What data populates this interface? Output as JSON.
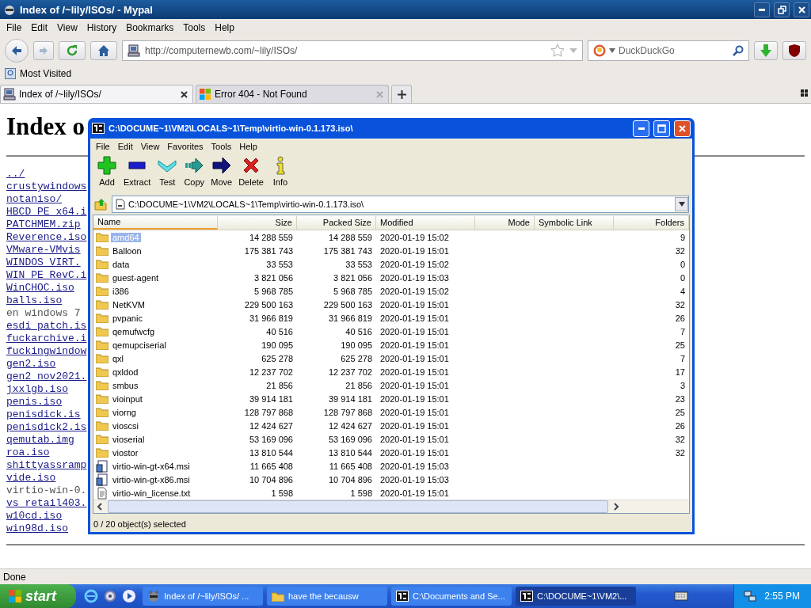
{
  "browser": {
    "title": "Index of /~lily/ISOs/ - Mypal",
    "menu": [
      "File",
      "Edit",
      "View",
      "History",
      "Bookmarks",
      "Tools",
      "Help"
    ],
    "url": "http://computernewb.com/~lily/ISOs/",
    "search": {
      "placeholder": "DuckDuckGo"
    },
    "bookmarks": [
      "Most Visited"
    ],
    "tabs": [
      {
        "label": "Index of /~lily/ISOs/",
        "selected": true,
        "kind": "page"
      },
      {
        "label": "Error 404 - Not Found",
        "selected": false,
        "kind": "error"
      }
    ],
    "status": "Done"
  },
  "page": {
    "heading": "Index o",
    "links": [
      {
        "text": "../",
        "visited": false
      },
      {
        "text": "crustywindows",
        "visited": false
      },
      {
        "text": "notaniso/",
        "visited": false
      },
      {
        "text": "HBCD PE x64.i",
        "visited": false
      },
      {
        "text": "PATCHMEM.zip",
        "visited": false
      },
      {
        "text": "Reverence.iso",
        "visited": false
      },
      {
        "text": "VMware-VMvis",
        "visited": false
      },
      {
        "text": "WINDOS VIRT.",
        "visited": false
      },
      {
        "text": "WIN PE RevC.i",
        "visited": false
      },
      {
        "text": "WinCHOC.iso",
        "visited": false
      },
      {
        "text": "balls.iso",
        "visited": false
      },
      {
        "text": "en windows 7",
        "visited": true
      },
      {
        "text": "esdi patch.is",
        "visited": false
      },
      {
        "text": "fuckarchive.i",
        "visited": false
      },
      {
        "text": "fuckingwindow",
        "visited": false
      },
      {
        "text": "gen2.iso",
        "visited": false
      },
      {
        "text": "gen2 nov2021.",
        "visited": false
      },
      {
        "text": "jxxlgb.iso",
        "visited": false
      },
      {
        "text": "penis.iso",
        "visited": false
      },
      {
        "text": "penisdick.is",
        "visited": false
      },
      {
        "text": "penisdick2.is",
        "visited": false
      },
      {
        "text": "qemutab.img",
        "visited": false
      },
      {
        "text": "roa.iso",
        "visited": false
      },
      {
        "text": "shittyassramp",
        "visited": false
      },
      {
        "text": "vide.iso",
        "visited": false
      },
      {
        "text": "virtio-win-0.",
        "visited": true
      },
      {
        "text": "vs retail403.",
        "visited": false
      },
      {
        "text": "w10cd.iso",
        "visited": false
      },
      {
        "text": "win98d.iso",
        "visited": false
      }
    ]
  },
  "archive_window": {
    "title": "C:\\DOCUME~1\\VM2\\LOCALS~1\\Temp\\virtio-win-0.1.173.iso\\",
    "menu": [
      "File",
      "Edit",
      "View",
      "Favorites",
      "Tools",
      "Help"
    ],
    "toolbar": [
      "Add",
      "Extract",
      "Test",
      "Copy",
      "Move",
      "Delete",
      "Info"
    ],
    "path": "C:\\DOCUME~1\\VM2\\LOCALS~1\\Temp\\virtio-win-0.1.173.iso\\",
    "columns": [
      "Name",
      "Size",
      "Packed Size",
      "Modified",
      "Mode",
      "Symbolic Link",
      "Folders"
    ],
    "rows": [
      {
        "kind": "folder",
        "name": "amd64",
        "size": "14 288 559",
        "packed_size": "14 288 559",
        "modified": "2020-01-19 15:02",
        "folders": "9",
        "selected": true
      },
      {
        "kind": "folder",
        "name": "Balloon",
        "size": "175 381 743",
        "packed_size": "175 381 743",
        "modified": "2020-01-19 15:01",
        "folders": "32",
        "selected": false
      },
      {
        "kind": "folder",
        "name": "data",
        "size": "33 553",
        "packed_size": "33 553",
        "modified": "2020-01-19 15:02",
        "folders": "0",
        "selected": false
      },
      {
        "kind": "folder",
        "name": "guest-agent",
        "size": "3 821 056",
        "packed_size": "3 821 056",
        "modified": "2020-01-19 15:03",
        "folders": "0",
        "selected": false
      },
      {
        "kind": "folder",
        "name": "i386",
        "size": "5 968 785",
        "packed_size": "5 968 785",
        "modified": "2020-01-19 15:02",
        "folders": "4",
        "selected": false
      },
      {
        "kind": "folder",
        "name": "NetKVM",
        "size": "229 500 163",
        "packed_size": "229 500 163",
        "modified": "2020-01-19 15:01",
        "folders": "32",
        "selected": false
      },
      {
        "kind": "folder",
        "name": "pvpanic",
        "size": "31 966 819",
        "packed_size": "31 966 819",
        "modified": "2020-01-19 15:01",
        "folders": "26",
        "selected": false
      },
      {
        "kind": "folder",
        "name": "qemufwcfg",
        "size": "40 516",
        "packed_size": "40 516",
        "modified": "2020-01-19 15:01",
        "folders": "7",
        "selected": false
      },
      {
        "kind": "folder",
        "name": "qemupciserial",
        "size": "190 095",
        "packed_size": "190 095",
        "modified": "2020-01-19 15:01",
        "folders": "25",
        "selected": false
      },
      {
        "kind": "folder",
        "name": "qxl",
        "size": "625 278",
        "packed_size": "625 278",
        "modified": "2020-01-19 15:01",
        "folders": "7",
        "selected": false
      },
      {
        "kind": "folder",
        "name": "qxldod",
        "size": "12 237 702",
        "packed_size": "12 237 702",
        "modified": "2020-01-19 15:01",
        "folders": "17",
        "selected": false
      },
      {
        "kind": "folder",
        "name": "smbus",
        "size": "21 856",
        "packed_size": "21 856",
        "modified": "2020-01-19 15:01",
        "folders": "3",
        "selected": false
      },
      {
        "kind": "folder",
        "name": "vioinput",
        "size": "39 914 181",
        "packed_size": "39 914 181",
        "modified": "2020-01-19 15:01",
        "folders": "23",
        "selected": false
      },
      {
        "kind": "folder",
        "name": "viorng",
        "size": "128 797 868",
        "packed_size": "128 797 868",
        "modified": "2020-01-19 15:01",
        "folders": "25",
        "selected": false
      },
      {
        "kind": "folder",
        "name": "vioscsi",
        "size": "12 424 627",
        "packed_size": "12 424 627",
        "modified": "2020-01-19 15:01",
        "folders": "26",
        "selected": false
      },
      {
        "kind": "folder",
        "name": "vioserial",
        "size": "53 169 096",
        "packed_size": "53 169 096",
        "modified": "2020-01-19 15:01",
        "folders": "32",
        "selected": false
      },
      {
        "kind": "folder",
        "name": "viostor",
        "size": "13 810 544",
        "packed_size": "13 810 544",
        "modified": "2020-01-19 15:01",
        "folders": "32",
        "selected": false
      },
      {
        "kind": "installer",
        "name": "virtio-win-gt-x64.msi",
        "size": "11 665 408",
        "packed_size": "11 665 408",
        "modified": "2020-01-19 15:03",
        "selected": false
      },
      {
        "kind": "installer",
        "name": "virtio-win-gt-x86.msi",
        "size": "10 704 896",
        "packed_size": "10 704 896",
        "modified": "2020-01-19 15:03",
        "selected": false
      },
      {
        "kind": "text",
        "name": "virtio-win_license.txt",
        "size": "1 598",
        "packed_size": "1 598",
        "modified": "2020-01-19 15:01",
        "selected": false
      }
    ],
    "status": "0 / 20 object(s) selected"
  },
  "taskbar": {
    "start": "start",
    "tasks": [
      {
        "label": "Index of /~lily/ISOs/ ...",
        "kind": "browser",
        "selected": false
      },
      {
        "label": "have the becausw",
        "kind": "folder",
        "selected": false
      },
      {
        "label": "C:\\Documents and Se...",
        "kind": "archive",
        "selected": false
      },
      {
        "label": "C:\\DOCUME~1\\VM2\\...",
        "kind": "archive",
        "selected": true
      }
    ],
    "clock": "2:55 PM"
  }
}
